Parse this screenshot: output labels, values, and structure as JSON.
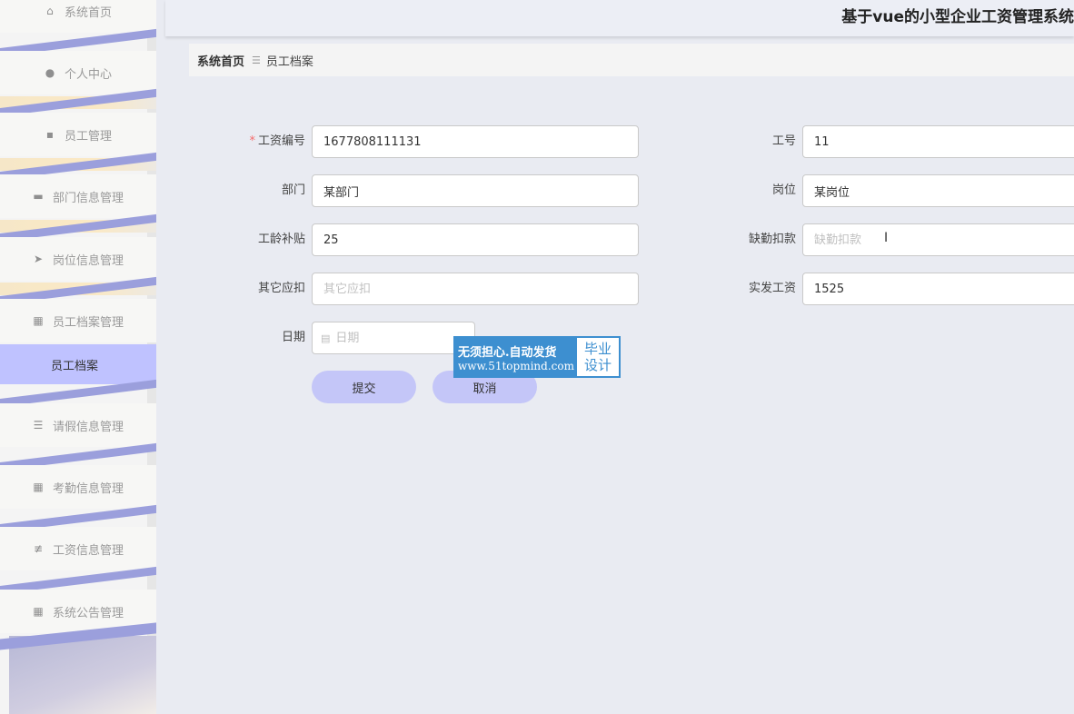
{
  "header": {
    "title": "基于vue的小型企业工资管理系统"
  },
  "breadcrumb": {
    "home": "系统首页",
    "separator": "☰",
    "current": "员工档案"
  },
  "sidebar": {
    "items": [
      {
        "label": "系统首页",
        "icon": "home-icon"
      },
      {
        "label": "个人中心",
        "icon": "user-icon"
      },
      {
        "label": "员工管理",
        "icon": "chat-icon"
      },
      {
        "label": "部门信息管理",
        "icon": "monitor-icon"
      },
      {
        "label": "岗位信息管理",
        "icon": "send-icon"
      },
      {
        "label": "员工档案管理",
        "icon": "grid-icon"
      },
      {
        "label": "员工档案",
        "icon": "",
        "active": true
      },
      {
        "label": "请假信息管理",
        "icon": "list-icon"
      },
      {
        "label": "考勤信息管理",
        "icon": "grid-icon"
      },
      {
        "label": "工资信息管理",
        "icon": "sliders-icon"
      },
      {
        "label": "系统公告管理",
        "icon": "grid-icon"
      }
    ]
  },
  "form": {
    "salary_no": {
      "label": "工资编号",
      "required": "*",
      "value": "1677808111131"
    },
    "job_no": {
      "label": "工号",
      "value": "11"
    },
    "department": {
      "label": "部门",
      "value": "某部门"
    },
    "position": {
      "label": "岗位",
      "value": "某岗位"
    },
    "seniority_allowance": {
      "label": "工龄补贴",
      "value": "25"
    },
    "absence_deduction": {
      "label": "缺勤扣款",
      "value": "",
      "placeholder": "缺勤扣款"
    },
    "other_deduction": {
      "label": "其它应扣",
      "value": "",
      "placeholder": "其它应扣"
    },
    "net_salary": {
      "label": "实发工资",
      "value": "1525"
    },
    "date": {
      "label": "日期",
      "value": "",
      "placeholder": "日期"
    }
  },
  "buttons": {
    "submit": "提交",
    "cancel": "取消"
  },
  "watermark": {
    "line1": "无须担心.自动发货",
    "line2": "www.51topmind.com",
    "right1": "毕业",
    "right2": "设计"
  },
  "colors": {
    "accent": "#c4c6f8",
    "active_menu": "#bfc2ff",
    "band": "#9b9fdc",
    "required": "#f56c6c",
    "watermark": "#3d8fd0"
  }
}
